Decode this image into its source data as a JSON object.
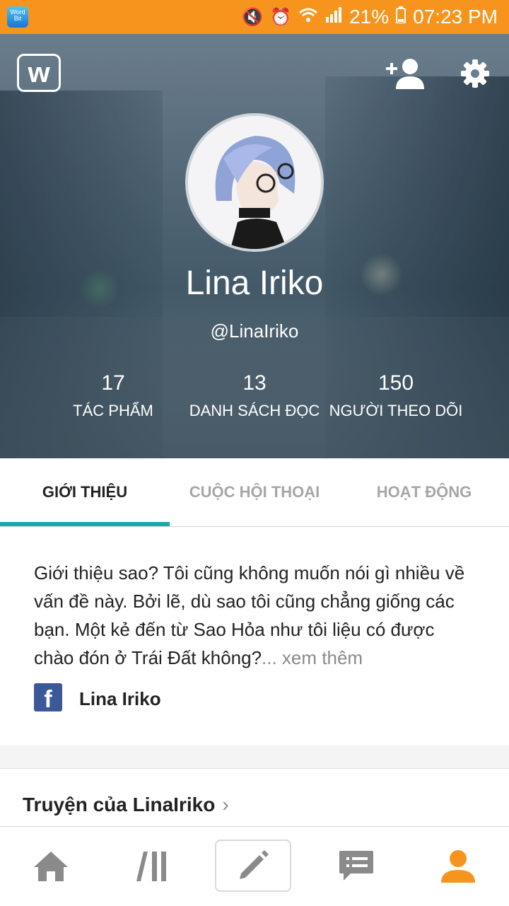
{
  "status_bar": {
    "app_icon_text": "Word Bit",
    "battery": "21%",
    "time": "07:23 PM",
    "icons": [
      "mute-icon",
      "alarm-icon",
      "wifi-icon",
      "signal-icon",
      "battery-icon"
    ]
  },
  "header": {
    "logo_letter": "w",
    "icons": [
      "add-user-icon",
      "gear-icon"
    ]
  },
  "profile": {
    "name": "Lina Iriko",
    "handle": "@LinaIriko",
    "stats": [
      {
        "value": "17",
        "label": "TÁC PHẨM"
      },
      {
        "value": "13",
        "label": "DANH SÁCH ĐỌC"
      },
      {
        "value": "150",
        "label": "NGƯỜI THEO DÕI"
      }
    ]
  },
  "tabs": [
    {
      "label": "GIỚI THIỆU",
      "active": true
    },
    {
      "label": "CUỘC HỘI THOẠI",
      "active": false
    },
    {
      "label": "HOẠT ĐỘNG",
      "active": false
    }
  ],
  "about": {
    "text": "Giới thiệu sao? Tôi cũng không muốn nói gì nhiều về vấn đề này. Bởi lẽ, dù sao tôi cũng chẳng giống các bạn. Một kẻ đến từ Sao Hỏa như tôi liệu có được chào đón ở Trái Đất không?",
    "more": "... xem thêm",
    "facebook_name": "Lina Iriko",
    "facebook_letter": "f"
  },
  "stories": {
    "title": "Truyện của LinaIriko",
    "chevron": "›"
  },
  "bottom_nav": [
    "home-icon",
    "library-icon",
    "write-icon",
    "messages-icon",
    "profile-icon"
  ],
  "colors": {
    "status_bar": "#f7941d",
    "accent_teal": "#17a9ad",
    "active_nav": "#f7941d",
    "inactive_nav": "#8a8a8a",
    "facebook": "#3b5998"
  }
}
